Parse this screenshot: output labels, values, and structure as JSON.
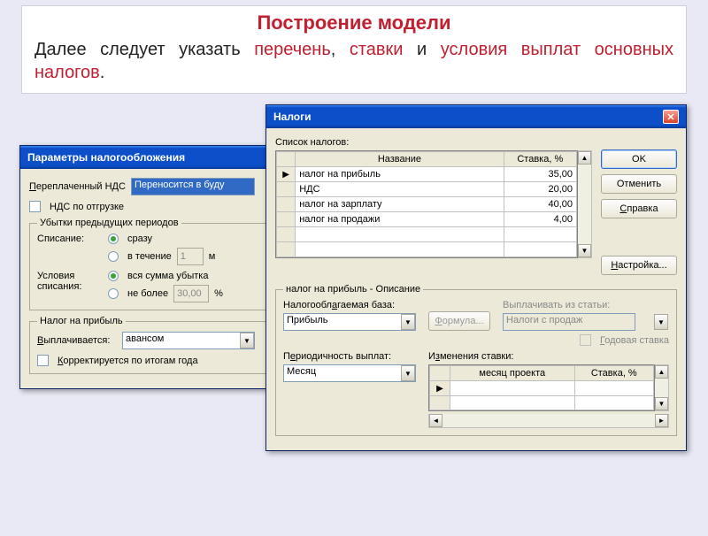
{
  "slide": {
    "title": "Построение модели",
    "sub_part1": "Далее следует указать ",
    "sub_hl1": "перечень",
    "sub_sep1": ", ",
    "sub_hl2": "ставки",
    "sub_sep2": " и ",
    "sub_hl3": "условия выплат основных налогов",
    "sub_end": "."
  },
  "params": {
    "title": "Параметры налогообложения",
    "vat_overpaid_label": "Переплаченный НДС",
    "vat_overpaid_value": "Переносится в буду",
    "vat_by_shipment": "НДС по отгрузке",
    "losses_group": "Убытки предыдущих периодов",
    "writeoff_label": "Списание:",
    "writeoff_opt1": "сразу",
    "writeoff_opt2": "в течение",
    "writeoff_period": "1",
    "writeoff_unit": "м",
    "cond_label": "Условия списания:",
    "cond_opt1": "вся сумма убытка",
    "cond_opt2": "не более",
    "cond_value": "30,00",
    "cond_unit": "%",
    "profit_group": "Налог на прибыль",
    "paid_label": "Выплачивается:",
    "paid_value": "авансом",
    "adjusted_year": "Корректируется по итогам года"
  },
  "taxes": {
    "title": "Налоги",
    "list_label": "Список налогов:",
    "col_name": "Название",
    "col_rate": "Ставка, %",
    "rows": [
      {
        "name": "налог на прибыль",
        "rate": "35,00"
      },
      {
        "name": "НДС",
        "rate": "20,00"
      },
      {
        "name": "налог на зарплату",
        "rate": "40,00"
      },
      {
        "name": "налог на продажи",
        "rate": "4,00"
      }
    ],
    "btn_ok": "OK",
    "btn_cancel": "Отменить",
    "btn_help": "Справка",
    "btn_settings": "Настройка...",
    "desc_group": "налог на прибыль - Описание",
    "base_label": "Налогооблагаемая база:",
    "base_value": "Прибыль",
    "formula_btn": "Формула...",
    "payfrom_label": "Выплачивать из статьи:",
    "payfrom_value": "Налоги с продаж",
    "annual_rate": "Годовая ставка",
    "period_label": "Периодичность выплат:",
    "period_value": "Месяц",
    "changes_label": "Изменения ставки:",
    "changes_col1": "месяц проекта",
    "changes_col2": "Ставка, %"
  }
}
